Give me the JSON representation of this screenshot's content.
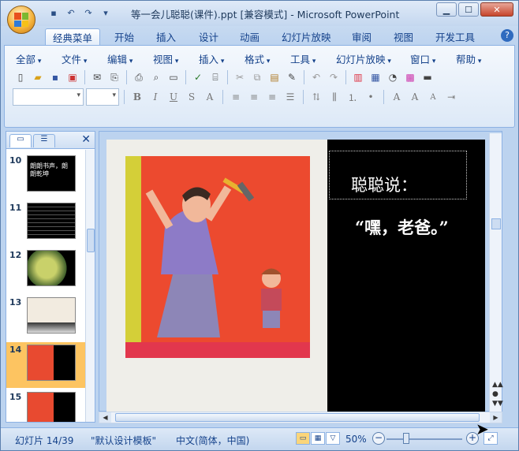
{
  "window": {
    "title": "等一会儿聪聪(课件).ppt [兼容模式] - Microsoft PowerPoint",
    "minimize": "▁",
    "maximize": "☐",
    "close": "✕"
  },
  "ribbon_tabs": [
    "经典菜单",
    "开始",
    "插入",
    "设计",
    "动画",
    "幻灯片放映",
    "审阅",
    "视图",
    "开发工具"
  ],
  "active_tab": "经典菜单",
  "help": "?",
  "menus": [
    "全部",
    "文件",
    "编辑",
    "视图",
    "插入",
    "格式",
    "工具",
    "幻灯片放映",
    "窗口",
    "帮助"
  ],
  "panel": {
    "tab_slides": "▭",
    "tab_outline": "☰",
    "close": "✕"
  },
  "thumbnails": [
    {
      "num": "10",
      "text": "朗朗书声，朗朗乾坤"
    },
    {
      "num": "11",
      "text": ""
    },
    {
      "num": "12",
      "text": ""
    },
    {
      "num": "13",
      "text": ""
    },
    {
      "num": "14",
      "text": ""
    },
    {
      "num": "15",
      "text": ""
    }
  ],
  "selected_slide": "14",
  "slide": {
    "line1": "聪聪说：",
    "line2": "“嘿，老爸。”"
  },
  "status": {
    "slide_info": "幻灯片 14/39",
    "template": "\"默认设计模板\"",
    "language": "中文(简体，中国)",
    "zoom": "50%"
  },
  "colors": {
    "accent": "#15428b",
    "ribbon_bg": "#bcd3ef",
    "selected_thumb": "#fdc461"
  }
}
